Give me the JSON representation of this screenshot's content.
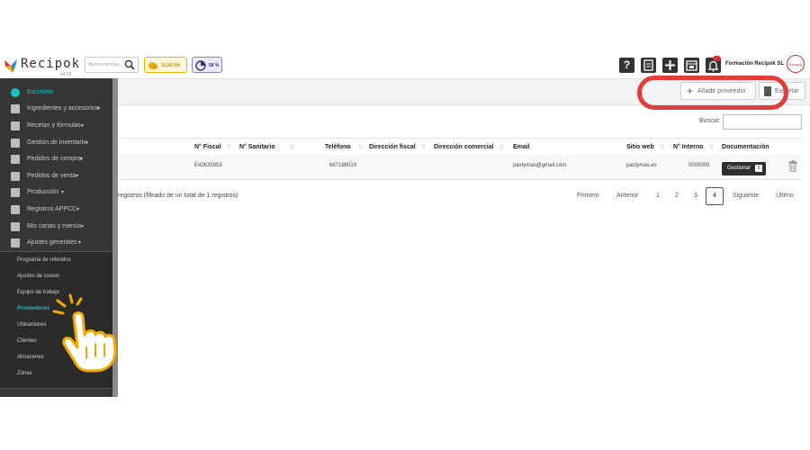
{
  "app": {
    "logo_text": "Recipok",
    "version": "v4.19",
    "search_placeholder": "Buscar recetas...",
    "cost_badge": "31,60 €/h",
    "percent_badge": "58 %",
    "toolbar_icons": [
      "help-icon",
      "notes-icon",
      "plus-icon",
      "calendar-icon",
      "bell-icon"
    ],
    "help_label": "?",
    "user_name": "Formación Recipok SL",
    "accent_color": "#18c1c1",
    "highlight_color": "#e43b3b"
  },
  "sidebar": {
    "items": [
      {
        "label": "Escritorio",
        "icon": "dashboard-icon",
        "has_caret": false,
        "active": true
      },
      {
        "label": "Ingredientes y accesorios",
        "icon": "whisk-icon",
        "has_caret": true
      },
      {
        "label": "Recetas y fórmulas",
        "icon": "recipe-icon",
        "has_caret": true
      },
      {
        "label": "Gestión de inventario",
        "icon": "inventory-icon",
        "has_caret": true
      },
      {
        "label": "Pedidos de compra",
        "icon": "purchase-icon",
        "has_caret": true
      },
      {
        "label": "Pedidos de venta",
        "icon": "sales-icon",
        "has_caret": true
      },
      {
        "label": "Producción",
        "icon": "production-icon",
        "has_caret": true
      },
      {
        "label": "Registros APPCC",
        "icon": "appcc-icon",
        "has_caret": true
      },
      {
        "label": "Mis cartas y menús",
        "icon": "menu-icon",
        "has_caret": true
      },
      {
        "label": "Ajustes generales",
        "icon": "settings-icon",
        "has_caret": true
      }
    ],
    "submenu": [
      {
        "label": "Programa de referidos"
      },
      {
        "label": "Ajustes de costes"
      },
      {
        "label": "Equipo de trabajo"
      },
      {
        "label": "Proveedores",
        "active": true
      },
      {
        "label": "Ubicaciones"
      },
      {
        "label": "Clientes"
      },
      {
        "label": "Almacenes"
      },
      {
        "label": "Zonas"
      }
    ]
  },
  "toolbar": {
    "add_label": "Añadir proveedor",
    "export_label": "Exportar"
  },
  "search": {
    "label": "Buscar:",
    "value": ""
  },
  "table": {
    "columns": [
      "N° Fiscal",
      "N° Sanitario",
      "Teléfono",
      "Dirección fiscal",
      "Dirección comercial",
      "Email",
      "Sitio web",
      "N° Interno",
      "Documentación"
    ],
    "rows": [
      {
        "fiscal": "E42635953",
        "sanitario": "",
        "telefono": "687188019",
        "dir_fiscal": "",
        "dir_comercial": "",
        "email": "pastymas@gmail.com",
        "web": "pastymas.es",
        "interno": "0000000",
        "doc_button": "Gestionar",
        "doc_count": "0"
      }
    ]
  },
  "footer": {
    "info": "registros (filtrado de un total de 1 registros)",
    "pagination": [
      "Primero",
      "Anterior",
      "1",
      "2",
      "3",
      "4",
      "Siguiente",
      "Último"
    ],
    "current_page": "4"
  }
}
